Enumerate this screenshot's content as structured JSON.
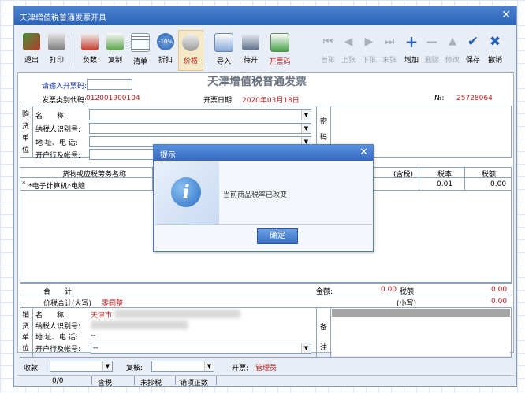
{
  "window": {
    "title": "天津增值税普通发票开具",
    "close_glyph": "✕"
  },
  "toolbar": {
    "buttons": [
      {
        "label": "退出",
        "icon": "exit-icon",
        "enabled": true
      },
      {
        "label": "打印",
        "icon": "printer-icon",
        "enabled": true
      },
      {
        "label": "负数",
        "icon": "negative-invoice-icon",
        "enabled": true
      },
      {
        "label": "复制",
        "icon": "copy-icon",
        "enabled": true
      },
      {
        "label": "清单",
        "icon": "list-icon",
        "enabled": true
      },
      {
        "label": "折扣",
        "icon": "discount-icon",
        "enabled": true,
        "badge": "-10%"
      },
      {
        "label": "价格",
        "icon": "price-icon",
        "enabled": true
      },
      {
        "label": "导入",
        "icon": "import-icon",
        "enabled": true
      },
      {
        "label": "待开",
        "icon": "pending-icon",
        "enabled": true
      },
      {
        "label": "开票码",
        "icon": "invoice-code-icon",
        "enabled": true
      },
      {
        "label": "首张",
        "icon": "first-icon",
        "enabled": false
      },
      {
        "label": "上张",
        "icon": "prev-icon",
        "enabled": false
      },
      {
        "label": "下张",
        "icon": "next-icon",
        "enabled": false
      },
      {
        "label": "末张",
        "icon": "last-icon",
        "enabled": false
      },
      {
        "label": "增加",
        "icon": "plus-icon",
        "enabled": true
      },
      {
        "label": "删除",
        "icon": "minus-icon",
        "enabled": false
      },
      {
        "label": "修改",
        "icon": "edit-icon",
        "enabled": false
      },
      {
        "label": "保存",
        "icon": "check-icon",
        "enabled": true
      },
      {
        "label": "撤销",
        "icon": "cancel-icon",
        "enabled": true
      }
    ]
  },
  "invoice": {
    "heading": "天津增值税普通发票",
    "code_prompt": "请输入开票码:",
    "category_code_label": "发票类别代码:",
    "category_code": "012001900104",
    "date_label": "开票日期:",
    "date": "2020年03月18日",
    "number_label": "№:",
    "number": "25728064"
  },
  "buyer": {
    "section_label": [
      "购",
      "货",
      "单",
      "位"
    ],
    "name_label": "名　　称:",
    "tax_id_label": "纳税人识别号:",
    "address_label": "地 址、电 话:",
    "bank_label": "开户行及帐号:",
    "password_label": [
      "密",
      "码"
    ]
  },
  "items_table": {
    "columns": [
      "货物或应税劳务名称",
      "规",
      "(含税)",
      "税率",
      "税额"
    ],
    "rows": [
      {
        "marker": "*",
        "name": "*电子计算机*电脑",
        "tax_rate": "0.01",
        "tax_amount": "0.00"
      }
    ]
  },
  "totals": {
    "subtotal_label": "合　　计",
    "amount_label": "金额:",
    "amount": "0.00",
    "tax_label": "税额:",
    "tax": "0.00",
    "grand_label": "价税合计(大写)",
    "grand_upper": "零圆整",
    "small_label": "(小写)",
    "small": "0.00"
  },
  "seller": {
    "section_label": [
      "销",
      "货",
      "单",
      "位"
    ],
    "name_label": "名　　称:",
    "name_value": "天津市",
    "tax_id_label": "纳税人识别号:",
    "address_label": "地 址、电 话:",
    "address_value": "--",
    "bank_label": "开户行及帐号:",
    "bank_value": "--",
    "remarks_label": [
      "备",
      "注"
    ]
  },
  "signature": {
    "payee_label": "收款:",
    "reviewer_label": "复核:",
    "issuer_label": "开票:",
    "issuer": "管理员"
  },
  "status": {
    "page": "0/0",
    "tax_mode": "含税",
    "copy_tax": "未抄税",
    "count": "销项正数"
  },
  "dialog": {
    "title": "提示",
    "message": "当前商品税率已改变",
    "ok_label": "确定",
    "close_glyph": "✕",
    "icon": "info-icon"
  },
  "colors": {
    "title_blue": "#2a62b6",
    "accent_red": "#b51c1c",
    "label_blue": "#1b3aa8"
  }
}
